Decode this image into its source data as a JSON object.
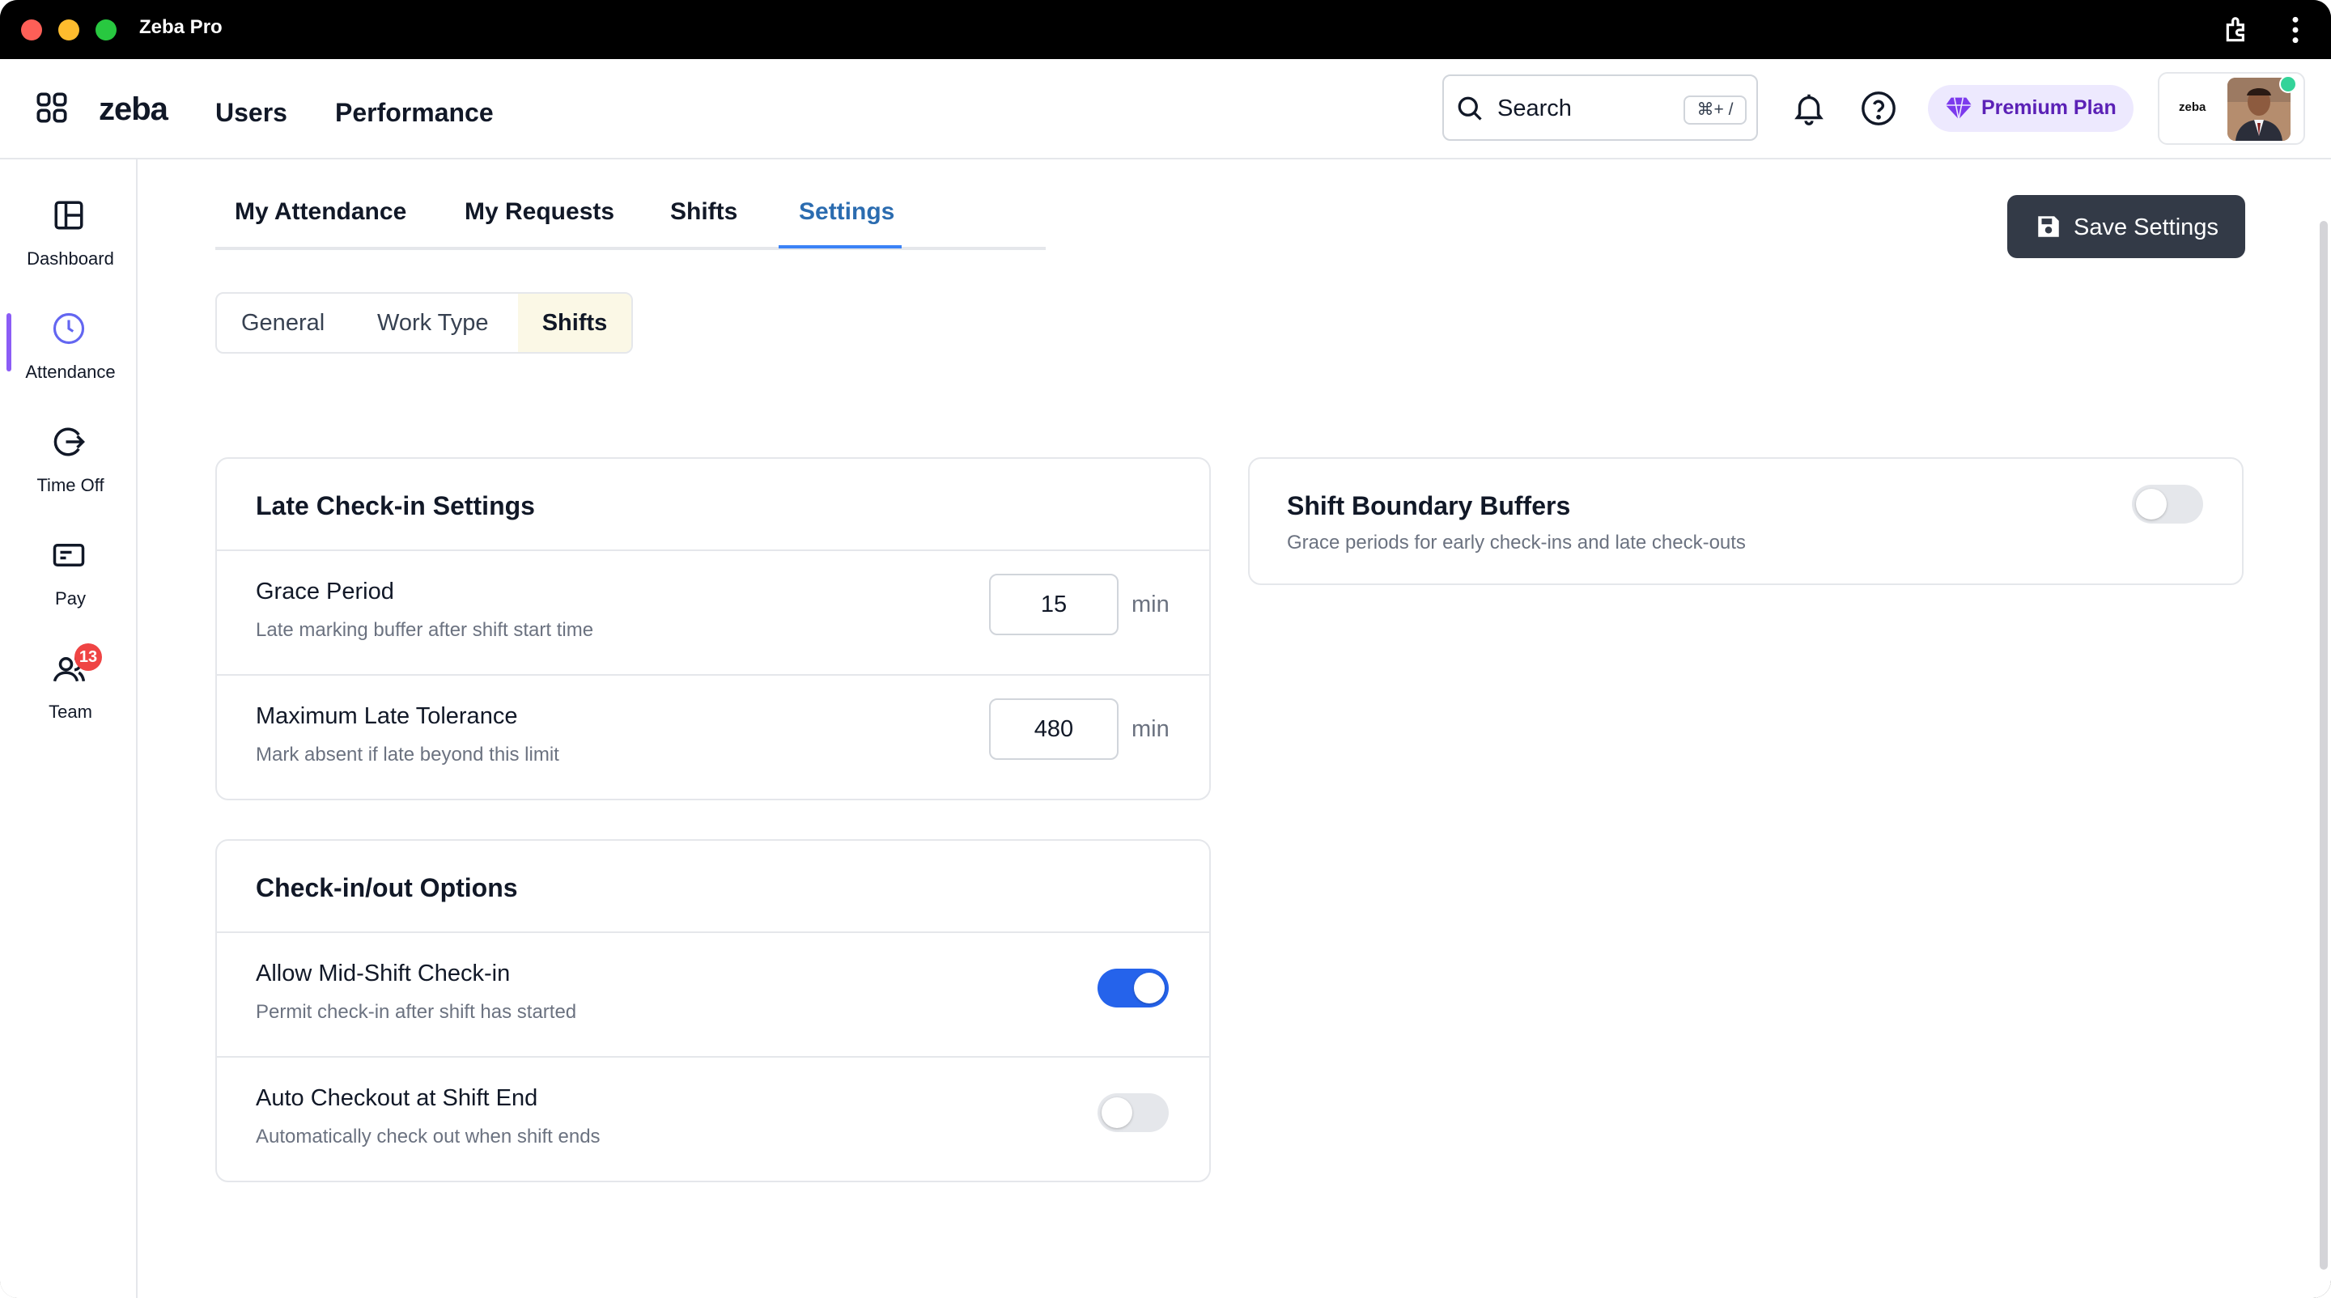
{
  "window": {
    "title": "Zeba Pro"
  },
  "header": {
    "logo_text": "zeba",
    "nav": [
      "Users",
      "Performance"
    ],
    "search": {
      "label": "Search",
      "shortcut": "⌘+ /"
    },
    "premium_label": "Premium Plan",
    "profile_logo_text": "zeba"
  },
  "sidebar": {
    "items": [
      {
        "label": "Dashboard",
        "icon": "dashboard-icon"
      },
      {
        "label": "Attendance",
        "icon": "clock-icon",
        "active": true
      },
      {
        "label": "Time Off",
        "icon": "time-off-icon"
      },
      {
        "label": "Pay",
        "icon": "pay-icon"
      },
      {
        "label": "Team",
        "icon": "team-icon",
        "badge": "13"
      }
    ]
  },
  "tabs": [
    "My Attendance",
    "My Requests",
    "Shifts",
    "Settings"
  ],
  "active_tab": "Settings",
  "save_button": "Save Settings",
  "subtabs": [
    "General",
    "Work Type",
    "Shifts"
  ],
  "active_subtab": "Shifts",
  "late_checkin": {
    "title": "Late Check-in Settings",
    "grace": {
      "title": "Grace Period",
      "subtitle": "Late marking buffer after shift start time",
      "value": "15",
      "unit": "min"
    },
    "max_late": {
      "title": "Maximum Late Tolerance",
      "subtitle": "Mark absent if late beyond this limit",
      "value": "480",
      "unit": "min"
    }
  },
  "checkinout": {
    "title": "Check-in/out Options",
    "mid_shift": {
      "title": "Allow Mid-Shift Check-in",
      "subtitle": "Permit check-in after shift has started",
      "enabled": true
    },
    "auto_checkout": {
      "title": "Auto Checkout at Shift End",
      "subtitle": "Automatically check out when shift ends",
      "enabled": false
    }
  },
  "boundary": {
    "title": "Shift Boundary Buffers",
    "subtitle": "Grace periods for early check-ins and late check-outs",
    "enabled": false
  },
  "colors": {
    "accent": "#2563eb",
    "active_tab": "#2b6cb0",
    "sidebar_active": "#8b5cf6",
    "badge": "#ef4444",
    "premium_bg": "#ede9fe",
    "premium_text": "#5b21b6",
    "save_bg": "#333a47"
  }
}
